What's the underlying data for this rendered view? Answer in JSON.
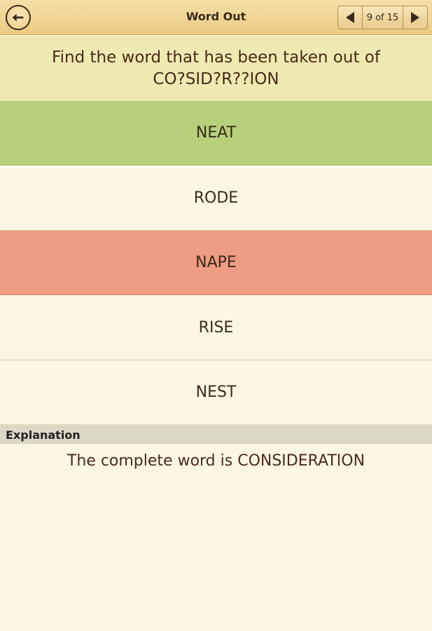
{
  "header": {
    "title": "Word Out",
    "back_icon": "back-arrow-icon",
    "pager": {
      "prev_icon": "triangle-left-icon",
      "next_icon": "triangle-right-icon",
      "count": "9 of 15"
    }
  },
  "question": {
    "line1": "Find the word that has been taken out of",
    "line2": "CO?SID?R??ION"
  },
  "options": [
    {
      "label": "NEAT",
      "state": "correct"
    },
    {
      "label": "RODE",
      "state": "plain"
    },
    {
      "label": "NAPE",
      "state": "wrong"
    },
    {
      "label": "RISE",
      "state": "plain"
    },
    {
      "label": "NEST",
      "state": "plain"
    }
  ],
  "explanation": {
    "header": "Explanation",
    "text": "The complete word is CONSIDERATION"
  },
  "colors": {
    "correct": "#b6d07c",
    "wrong": "#ee9c82",
    "question_bg": "#eeeab2",
    "page_bg": "#fcf7e4"
  }
}
